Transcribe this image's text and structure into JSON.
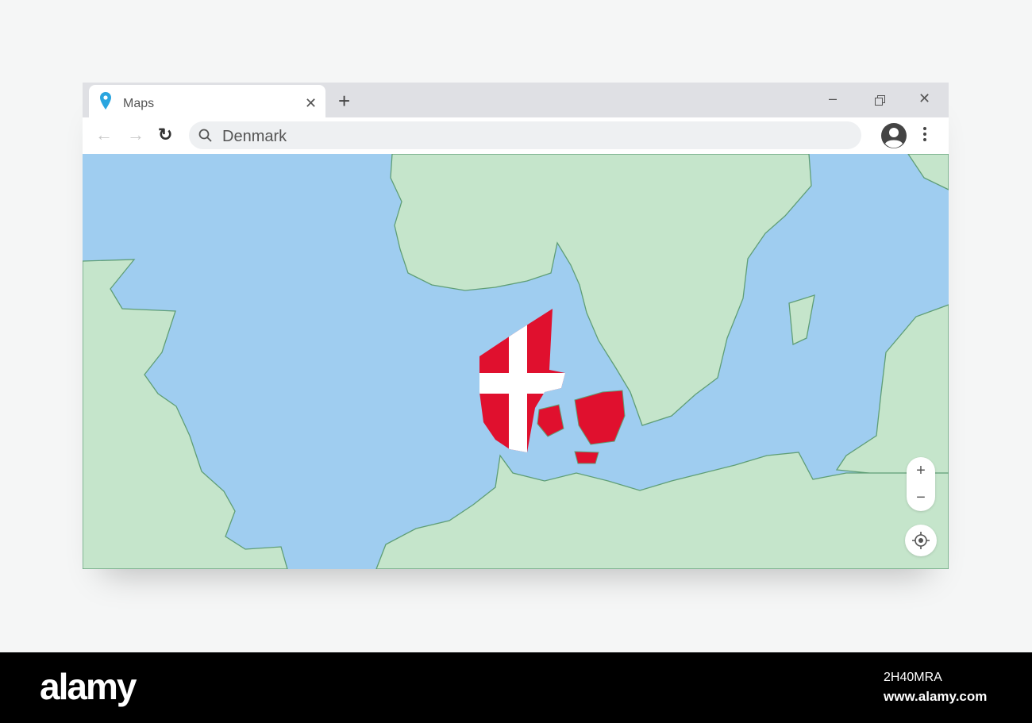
{
  "browser": {
    "tab_title": "Maps",
    "search_query": "Denmark"
  },
  "map": {
    "country": "Denmark",
    "colors": {
      "water": "#9fcdf0",
      "land": "#c5e5cb",
      "coast": "#5f9e76",
      "flag_red": "#e0102e"
    },
    "zoom_in": "+",
    "zoom_out": "−"
  },
  "footer": {
    "brand": "alamy",
    "image_id": "2H40MRA",
    "url": "www.alamy.com"
  }
}
